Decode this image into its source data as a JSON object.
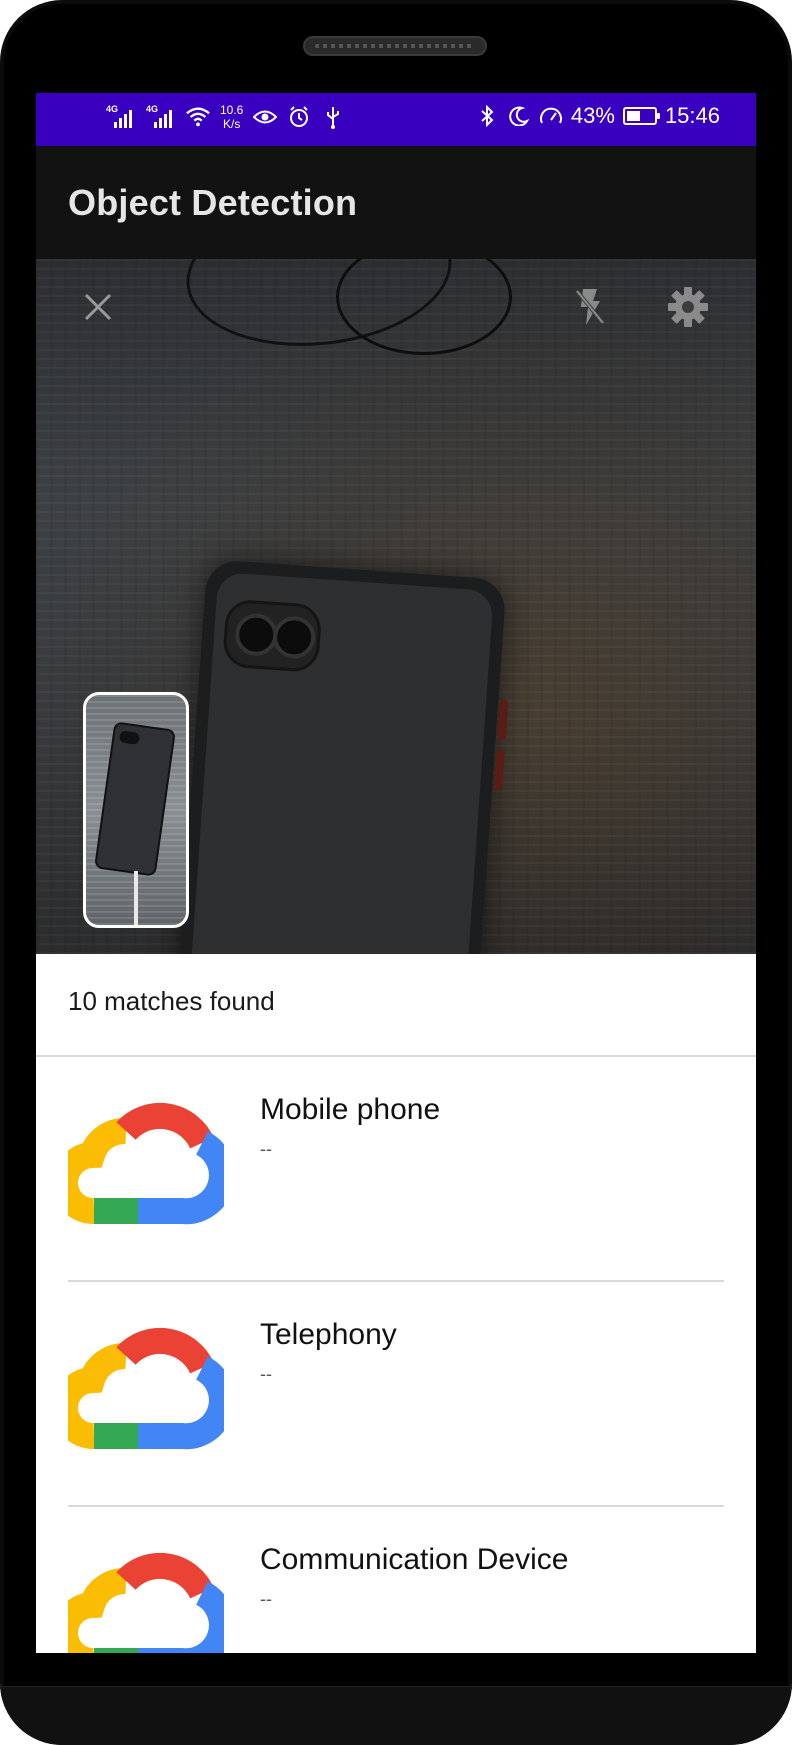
{
  "status_bar": {
    "net1": "4G",
    "net2": "4G",
    "speed_top": "10.6",
    "speed_bottom": "K/s",
    "battery": "43%",
    "time": "15:46",
    "background_color": "#3a00bf"
  },
  "app_bar": {
    "title": "Object Detection"
  },
  "camera": {
    "controls": {
      "close_icon": "close-icon",
      "flash_icon": "flash-off-icon",
      "settings_icon": "gear-icon"
    }
  },
  "results": {
    "count_text": "10 matches found",
    "items": [
      {
        "name": "Mobile phone",
        "sub": "--",
        "icon": "google-cloud-logo"
      },
      {
        "name": "Telephony",
        "sub": "--",
        "icon": "google-cloud-logo"
      },
      {
        "name": "Communication Device",
        "sub": "--",
        "icon": "google-cloud-logo"
      }
    ]
  }
}
